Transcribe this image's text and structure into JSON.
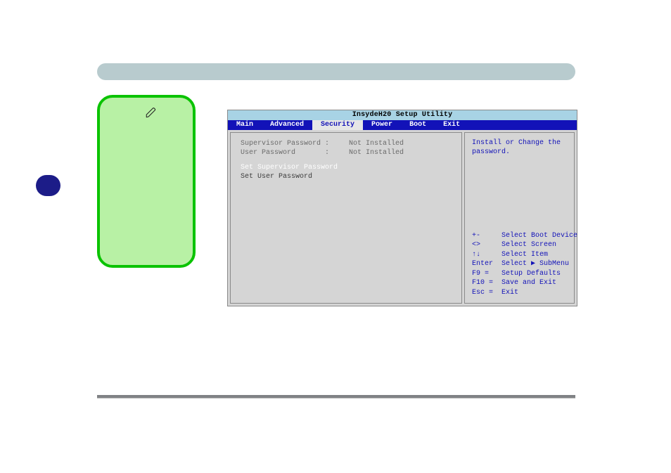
{
  "bios": {
    "title": "InsydeH20 Setup Utility",
    "tabs": {
      "main": "Main",
      "advanced": "Advanced",
      "security": "Security",
      "power": "Power",
      "boot": "Boot",
      "exit": "Exit"
    },
    "security": {
      "rows": {
        "supervisor_label": "Supervisor Password :",
        "supervisor_value": "Not Installed",
        "user_label": "User Password       :",
        "user_value": "Not Installed"
      },
      "set_supervisor": "Set Supervisor Password",
      "set_user": "Set User Password",
      "help_top": "Install or Change the password.",
      "hints": "+-     Select Boot Device\n<>     Select Screen\n↑↓     Select Item\nEnter  Select ▶ SubMenu\nF9 =   Setup Defaults\nF10 =  Save and Exit\nEsc =  Exit"
    }
  },
  "note": {
    "text_illegible": ""
  }
}
